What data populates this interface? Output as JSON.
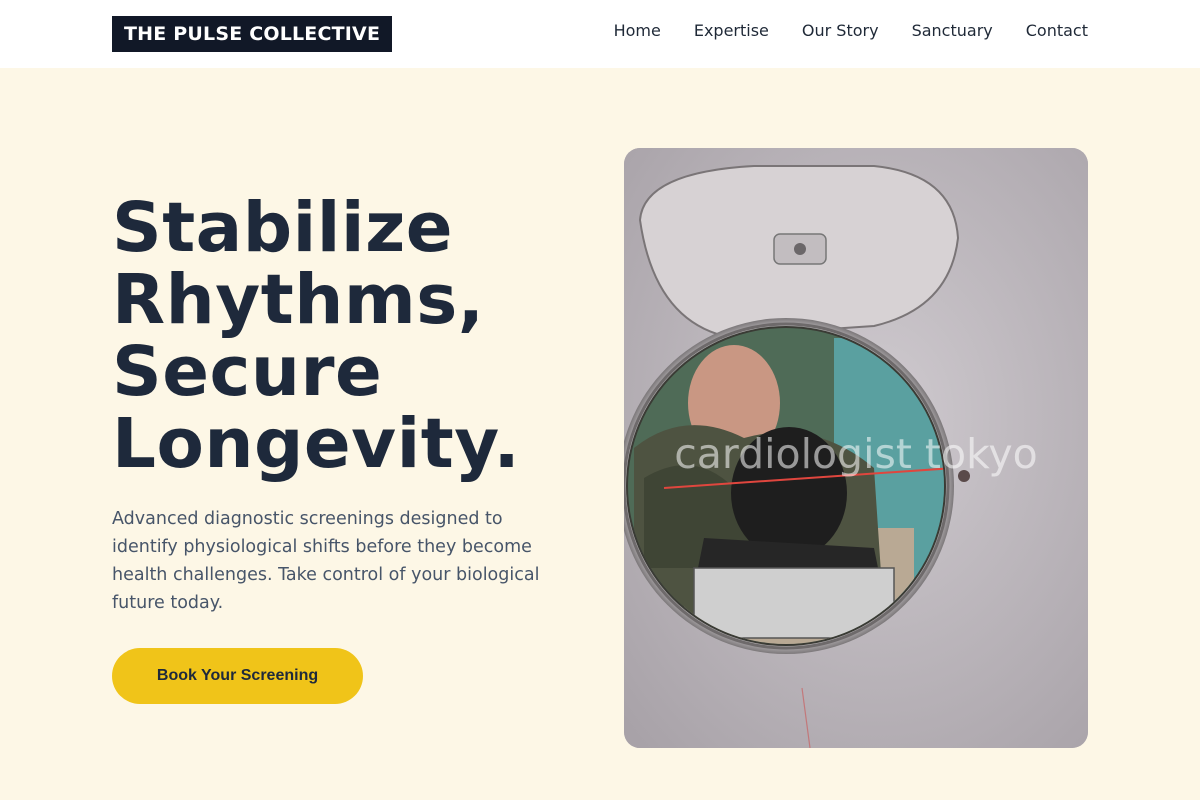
{
  "header": {
    "logo": "THE PULSE COLLECTIVE",
    "nav": [
      "Home",
      "Expertise",
      "Our Story",
      "Sanctuary",
      "Contact"
    ]
  },
  "hero": {
    "title_lines": [
      "Stabilize",
      "Rhythms,",
      "Secure",
      "Longevity."
    ],
    "description": "Advanced diagnostic screenings designed to identify physiological shifts before they become health challenges. Take control of your biological future today.",
    "cta": "Book Your Screening",
    "image_watermark": "cardiologist tokyo"
  },
  "colors": {
    "background": "#fdf7e6",
    "header_bg": "#ffffff",
    "logo_bg": "#111827",
    "heading": "#1e293b",
    "body_text": "#475569",
    "accent": "#f0c419"
  }
}
